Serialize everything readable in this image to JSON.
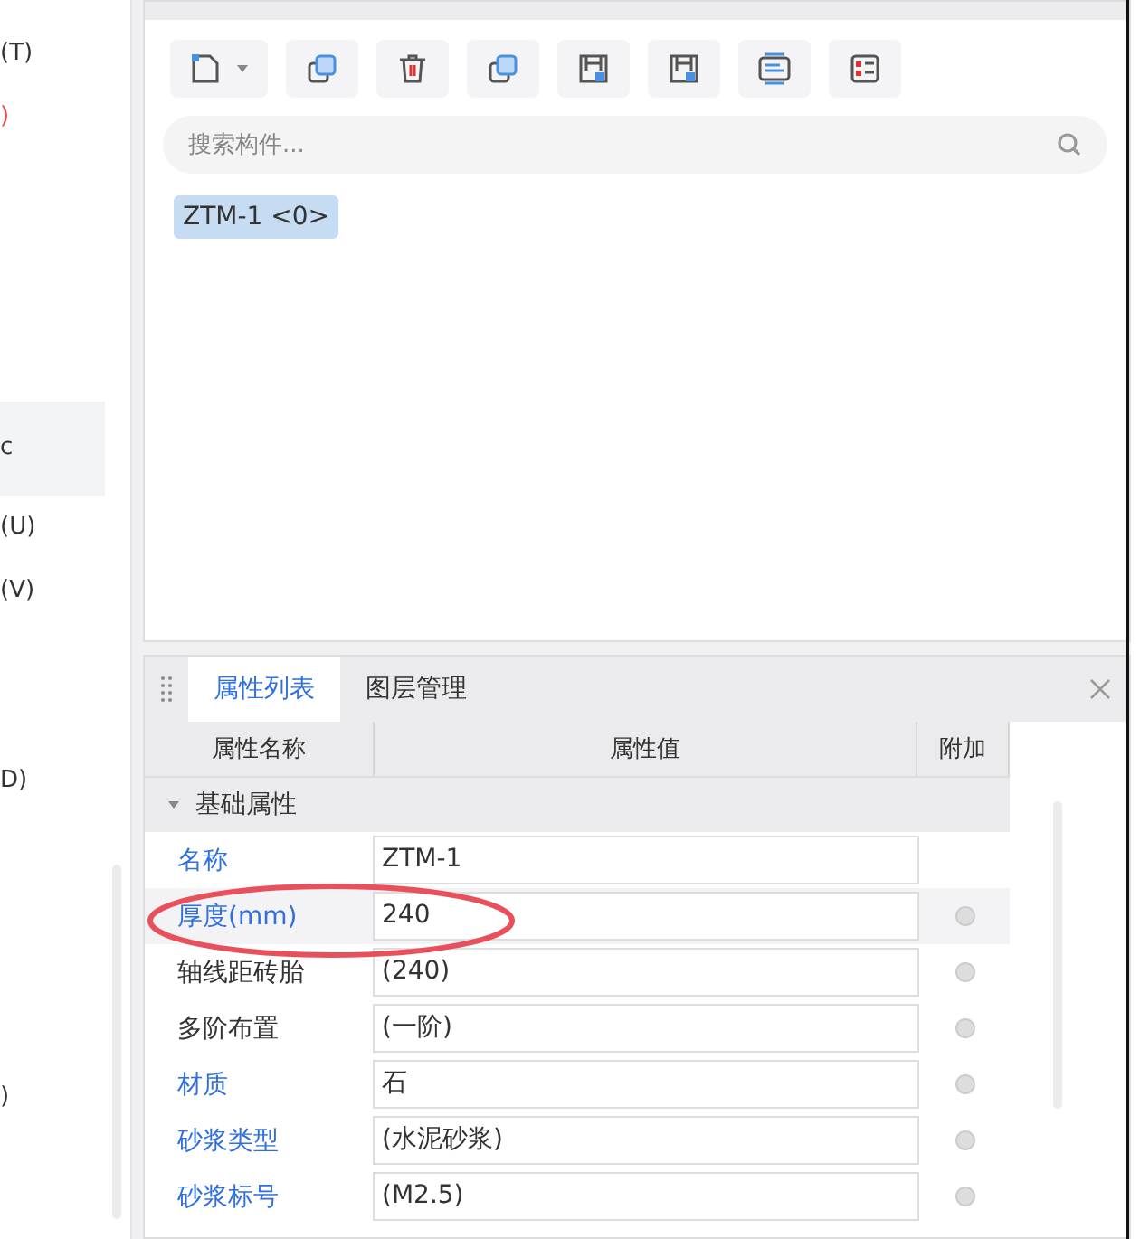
{
  "sidebar": {
    "items": [
      {
        "label": "(T)",
        "selected": false,
        "alert": false
      },
      {
        "label": ")",
        "selected": false,
        "alert": true
      },
      {
        "label": "c",
        "selected": true,
        "alert": false
      },
      {
        "label": "(U)",
        "selected": false,
        "alert": false
      },
      {
        "label": "(V)",
        "selected": false,
        "alert": false
      },
      {
        "label": "D)",
        "selected": false,
        "alert": false
      },
      {
        "label": ")",
        "selected": false,
        "alert": false
      }
    ]
  },
  "component_panel": {
    "search": {
      "placeholder": "搜索构件..."
    },
    "components": [
      {
        "label": "ZTM-1 <0>",
        "selected": true
      }
    ]
  },
  "property_panel": {
    "tabs": [
      {
        "label": "属性列表",
        "selected": true
      },
      {
        "label": "图层管理",
        "selected": false
      }
    ],
    "columns": [
      "属性名称",
      "属性值",
      "附加"
    ],
    "group": {
      "label": "基础属性",
      "expanded": true
    },
    "rows": [
      {
        "name": "名称",
        "value": "ZTM-1",
        "kind": "public",
        "selected": false,
        "extra": false
      },
      {
        "name": "厚度(mm)",
        "value": "240",
        "kind": "public",
        "selected": true,
        "extra": true
      },
      {
        "name": "轴线距砖胎",
        "value": "(240)",
        "kind": "private",
        "selected": false,
        "extra": true
      },
      {
        "name": "多阶布置",
        "value": "(一阶)",
        "kind": "private",
        "selected": false,
        "extra": true
      },
      {
        "name": "材质",
        "value": "石",
        "kind": "public",
        "selected": false,
        "extra": true
      },
      {
        "name": "砂浆类型",
        "value": "(水泥砂浆)",
        "kind": "public",
        "selected": false,
        "extra": true
      },
      {
        "name": "砂浆标号",
        "value": "(M2.5)",
        "kind": "public",
        "selected": false,
        "extra": true
      }
    ]
  }
}
